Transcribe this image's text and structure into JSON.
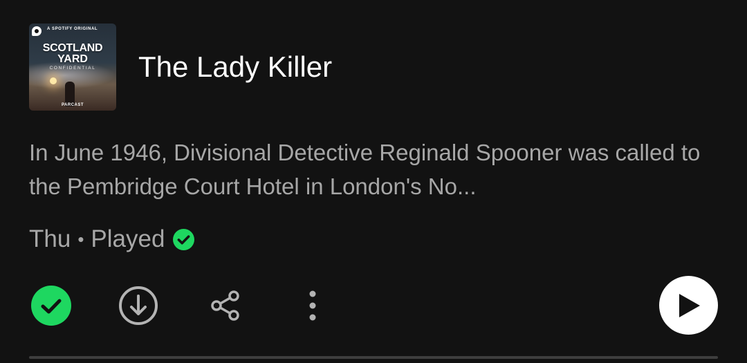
{
  "episode": {
    "cover": {
      "badge_text": "A SPOTIFY ORIGINAL",
      "title_line1": "SCOTLAND",
      "title_line2": "YARD",
      "title_line3": "CONFIDENTIAL",
      "brand": "PARCAST"
    },
    "title": "The Lady Killer",
    "description": "In June 1946, Divisional Detective Reginald Spooner was called to the Pembridge Court Hotel in London's No...",
    "meta": {
      "day": "Thu",
      "separator": "•",
      "status": "Played"
    }
  },
  "actions": {
    "played_icon": "check-circle-filled-icon",
    "download_icon": "download-circle-icon",
    "share_icon": "share-icon",
    "more_icon": "more-vertical-icon",
    "play_icon": "play-icon"
  },
  "colors": {
    "background": "#121212",
    "accent_green": "#1ed760",
    "text_primary": "#ffffff",
    "text_secondary": "#a7a7a7"
  }
}
